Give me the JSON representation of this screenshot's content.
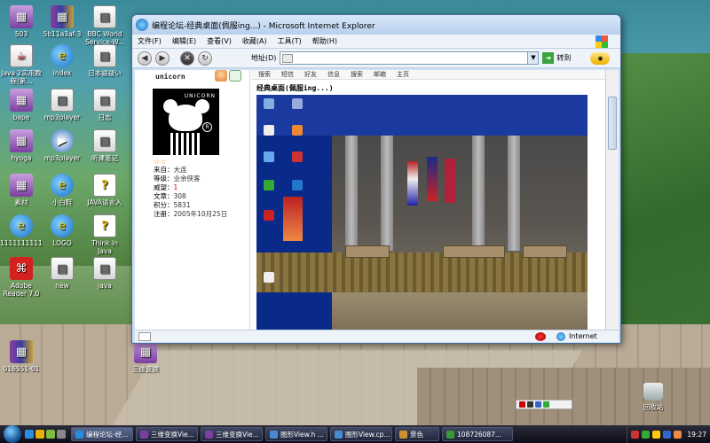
{
  "desktop": {
    "icons": [
      {
        "label": "503",
        "type": "purple"
      },
      {
        "label": "5b11a3af-3",
        "type": "rar"
      },
      {
        "label": "BBC World Service-W...",
        "type": "doc"
      },
      {
        "label": "Java 2实用教程(第...",
        "type": "java"
      },
      {
        "label": "index",
        "type": "ie"
      },
      {
        "label": "日本語疑い",
        "type": "doc"
      },
      {
        "label": "bape",
        "type": "purple"
      },
      {
        "label": "mp3player",
        "type": "doc"
      },
      {
        "label": "日志",
        "type": "doc"
      },
      {
        "label": "hyoga",
        "type": "purple"
      },
      {
        "label": "mp3player",
        "type": "media"
      },
      {
        "label": "听课笔记",
        "type": "doc"
      },
      {
        "label": "素材",
        "type": "purple"
      },
      {
        "label": "小白鞋",
        "type": "ie"
      },
      {
        "label": "JAVA语言入",
        "type": "q"
      },
      {
        "label": "1111111111",
        "type": "ie"
      },
      {
        "label": "LOGO",
        "type": "ie"
      },
      {
        "label": "Think In Java",
        "type": "q"
      },
      {
        "label": "Adobe Reader 7.0",
        "type": "pdf"
      },
      {
        "label": "new",
        "type": "doc"
      },
      {
        "label": "java",
        "type": "doc"
      },
      {
        "label": "016551-01",
        "type": "rar"
      },
      {
        "label": "三维变换",
        "type": "purple"
      }
    ],
    "recycle_bin": "回收站"
  },
  "ie_window": {
    "title": "编程论坛-经典桌面(佩服ing...) - Microsoft Internet Explorer",
    "menu": [
      "文件(F)",
      "编辑(E)",
      "查看(V)",
      "收藏(A)",
      "工具(T)",
      "帮助(H)"
    ],
    "address_label": "地址(D)",
    "address_value": "",
    "go_label": "转到",
    "status_zone": "Internet"
  },
  "post": {
    "username": "unicorn",
    "avatar_text": "UNICORN",
    "stars": "☆☆",
    "from_label": "来自：",
    "from": "大连",
    "level_label": "等级：",
    "level": "业余侠客",
    "prestige_label": "威望：",
    "prestige": "1",
    "posts_label": "文章：",
    "posts": "308",
    "points_label": "积分：",
    "points": "5831",
    "reg_label": "注册：",
    "reg": "2005年10月25日",
    "actions": [
      "搜索",
      "短信",
      "好友",
      "信息",
      "搜索",
      "邮箱",
      "主页"
    ],
    "title": "经典桌面(佩服ing...)"
  },
  "taskbar": {
    "tasks": [
      {
        "label": "编程论坛-经...",
        "active": true
      },
      {
        "label": "三维变换Vie...",
        "active": false
      },
      {
        "label": "三维变换Vie...",
        "active": false
      },
      {
        "label": "图形View.h ...",
        "active": false
      },
      {
        "label": "图形View.cp...",
        "active": false
      },
      {
        "label": "景色",
        "active": false
      },
      {
        "label": "108726087...",
        "active": false
      }
    ],
    "clock": "19:27"
  },
  "colors": {
    "accent": "#1a6fc7",
    "taskbar": "#0d0d18"
  }
}
